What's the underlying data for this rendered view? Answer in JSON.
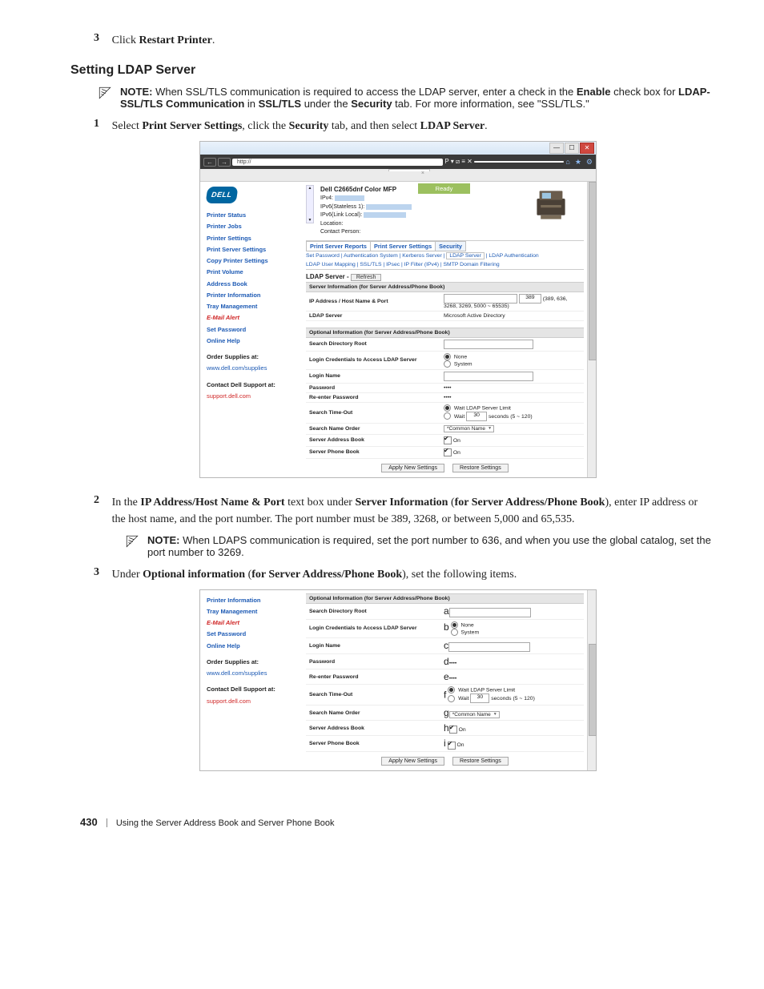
{
  "step3_num": "3",
  "step3_text_a": "Click ",
  "step3_text_b": "Restart Printer",
  "step3_text_c": ".",
  "heading": "Setting LDAP Server",
  "note1_label": "NOTE:",
  "note1_text_a": " When SSL/TLS communication is required to access the LDAP server, enter a check in the ",
  "note1_bold_a": "Enable",
  "note1_text_b": " check box for ",
  "note1_bold_b": "LDAP-SSL/TLS Communication",
  "note1_text_c": " in ",
  "note1_bold_c": "SSL/TLS",
  "note1_text_d": " under the ",
  "note1_bold_d": "Security",
  "note1_text_e": " tab. For more information, see \"SSL/TLS.\"",
  "step1_num": "1",
  "step1_a": "Select ",
  "step1_b": "Print Server Settings",
  "step1_c": ", click the ",
  "step1_d": "Security",
  "step1_e": " tab, and then select ",
  "step1_f": "LDAP Server",
  "step1_g": ".",
  "addrbar_url": "http://",
  "addrbar_right": "P ▾ ⧄ ≡ ✕",
  "tab_label": "",
  "device_name": "Dell C2665dnf Color MFP",
  "hdr_ipv4": "IPv4:",
  "hdr_ipv6s": "IPv6(Stateless 1):",
  "hdr_ipv6l": "IPv6(Link Local):",
  "hdr_loc": "Location:",
  "hdr_contact": "Contact Person:",
  "ready": "Ready",
  "nav": {
    "n1": "Printer Status",
    "n2": "Printer Jobs",
    "n3": "Printer Settings",
    "n4": "Print Server Settings",
    "n5": "Copy Printer Settings",
    "n6": "Print Volume",
    "n7": "Address Book",
    "n8": "Printer Information",
    "n9": "Tray Management",
    "n10": "E-Mail Alert",
    "n11": "Set Password",
    "n12": "Online Help",
    "os_lab": "Order Supplies at:",
    "os_url": "www.dell.com/supplies",
    "cd_lab": "Contact Dell Support at:",
    "cd_url": "support.dell.com"
  },
  "tabs2_a": "Print Server Reports",
  "tabs2_b": "Print Server Settings",
  "tabs2_c": "Security",
  "sub1": "Set Password | Authentication System | Kerberos Server |",
  "sub1_box": "LDAP Server",
  "sub1_end": "| LDAP Authentication",
  "sub2": "LDAP User Mapping | SSL/TLS | IPsec | IP Filter (IPv4) | SMTP Domain Filtering",
  "sec_head_a": "LDAP Server - ",
  "btn_refresh": "Refresh",
  "th_server_info": "Server Information (for Server Address/Phone Book)",
  "row_ip_lab": "IP Address / Host Name & Port",
  "row_ip_val": "389",
  "row_ip_hint": "(389, 636, 3268, 3269, 5000 ~ 65535)",
  "row_ldapsrv_lab": "LDAP Server",
  "row_ldapsrv_val": "Microsoft Active Directory",
  "th_optional": "Optional Information (for Server Address/Phone Book)",
  "row_sdr": "Search Directory Root",
  "row_cred": "Login Credentials to Access LDAP Server",
  "cred_none": "None",
  "cred_sys": "System",
  "row_login": "Login Name",
  "row_pw": "Password",
  "row_repw": "Re-enter Password",
  "pw_dots": "••••",
  "row_sto": "Search Time-Out",
  "sto_wait_srv": "Wait LDAP Server Limit",
  "sto_wait": "Wait",
  "sto_val": "30",
  "sto_hint": "seconds (5 ~ 120)",
  "row_sno": "Search Name Order",
  "sno_val": "*Common Name",
  "row_sab": "Server Address Book",
  "row_spb": "Server Phone Book",
  "chk_on": "On",
  "btn_apply": "Apply New Settings",
  "btn_restore": "Restore Settings",
  "step2_num": "2",
  "step2_a": "In the ",
  "step2_b": "IP Address/Host Name & Port",
  "step2_c": " text box under ",
  "step2_d": "Server Information",
  "step2_e": " (",
  "step2_f": "for Server Address/Phone Book",
  "step2_g": "), enter IP address or the host name, and the port number. The port number must be 389, 3268, or between 5,000 and 65,535.",
  "note2_label": "NOTE:",
  "note2_text": " When LDAPS communication is required, set the port number to 636, and when you use the global catalog, set the port number to 3269.",
  "step3b_num": "3",
  "step3b_a": "Under ",
  "step3b_b": "Optional information",
  "step3b_c": " (",
  "step3b_d": "for Server Address/Phone Book",
  "step3b_e": "), set the following items.",
  "callouts": {
    "a": "a",
    "b": "b",
    "c": "c",
    "d": "d",
    "e": "e",
    "f": "f",
    "g": "g",
    "h": "h",
    "i": "i"
  },
  "footer_page": "430",
  "footer_title": "Using the Server Address Book and Server Phone Book"
}
